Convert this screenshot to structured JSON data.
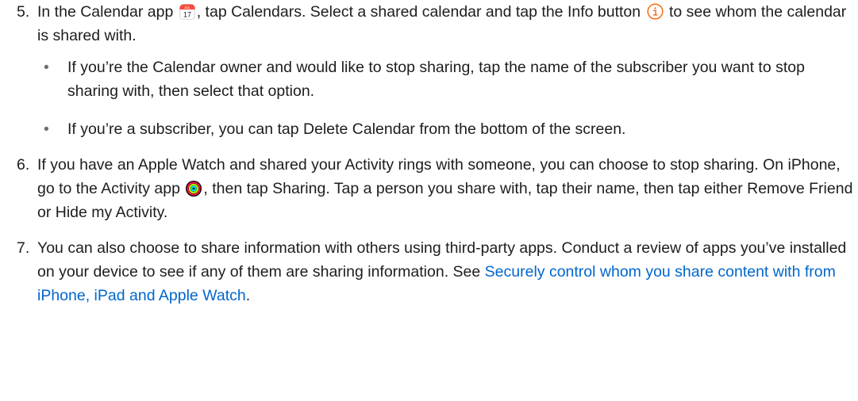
{
  "steps": [
    {
      "number": "5.",
      "pre": "In the Calendar app",
      "mid": ", tap Calendars. Select a shared calendar and tap the Info button",
      "post": "to see whom the calendar is shared with.",
      "calendar_icon": {
        "icon": "calendar-app-icon",
        "month": "JUL",
        "day": "17"
      },
      "info_icon": {
        "icon": "info-icon",
        "color": "#f56300"
      },
      "bullets": [
        "If you’re the Calendar owner and would like to stop sharing, tap the name of the subscriber you want to stop sharing with, then select that option.",
        "If you’re a subscriber, you can tap Delete Calendar from the bottom of the screen."
      ]
    },
    {
      "number": "6.",
      "pre": "If you have an Apple Watch and shared your Activity rings with someone, you can choose to stop sharing. On iPhone, go to the Activity app",
      "post": ", then tap Sharing. Tap a person you share with, tap their name, then tap either Remove Friend or Hide my Activity.",
      "activity_icon": {
        "icon": "activity-rings-icon"
      }
    },
    {
      "number": "7.",
      "pre": "You can also choose to share information with others using third-party apps. Conduct a review of apps you’ve installed on your device to see if any of them are sharing information. See ",
      "link": "Securely control whom you share content with from iPhone, iPad and Apple Watch",
      "post": ".",
      "link_color": "#0066cc"
    }
  ]
}
